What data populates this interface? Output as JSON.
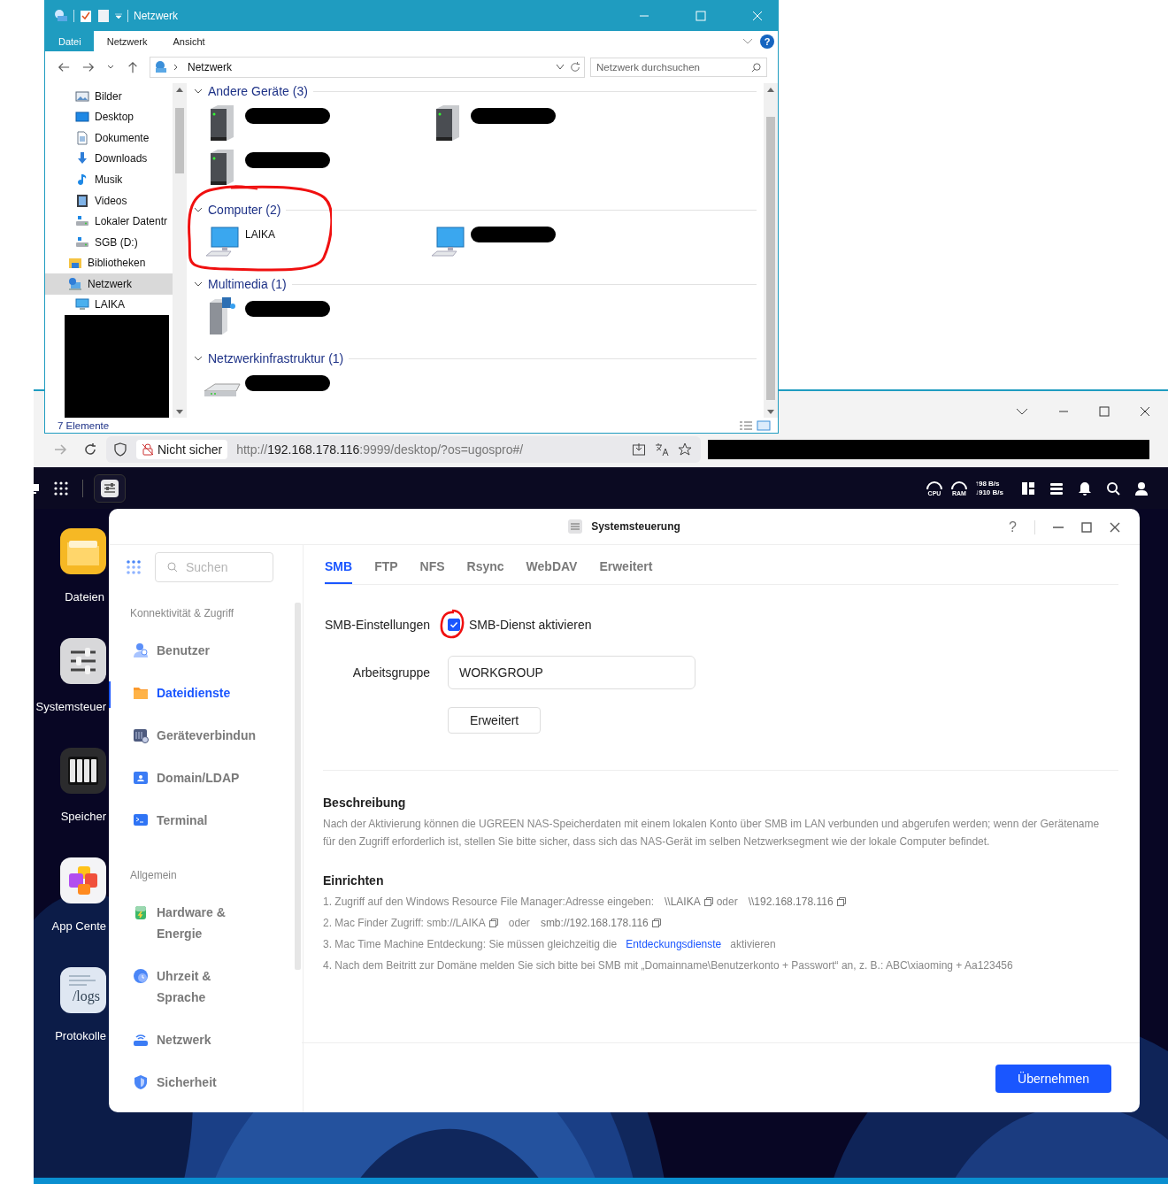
{
  "explorer": {
    "title": "Netzwerk",
    "ribbon_tabs": [
      {
        "label": "Datei",
        "selected": true
      },
      {
        "label": "Netzwerk",
        "selected": false
      },
      {
        "label": "Ansicht",
        "selected": false
      }
    ],
    "help": "?",
    "breadcrumb": "Netzwerk",
    "search": {
      "placeholder": "Netzwerk durchsuchen"
    },
    "nav_items": [
      {
        "label": "Bilder",
        "kind": "pictures",
        "selected": false
      },
      {
        "label": "Desktop",
        "kind": "desktop",
        "selected": false
      },
      {
        "label": "Dokumente",
        "kind": "documents",
        "selected": false
      },
      {
        "label": "Downloads",
        "kind": "downloads",
        "selected": false
      },
      {
        "label": "Musik",
        "kind": "music",
        "selected": false
      },
      {
        "label": "Videos",
        "kind": "videos",
        "selected": false
      },
      {
        "label": "Lokaler Datentr",
        "kind": "drive",
        "selected": false
      },
      {
        "label": "SGB (D:)",
        "kind": "drive",
        "selected": false
      },
      {
        "label": "Bibliotheken",
        "kind": "library",
        "selected": false
      },
      {
        "label": "Netzwerk",
        "kind": "network",
        "selected": true,
        "children": [
          {
            "label": "LAIKA",
            "kind": "computer",
            "selected": false
          }
        ]
      }
    ],
    "groups": [
      {
        "title": "Andere Geräte (3)",
        "devices": [
          {
            "kind": "server",
            "redacted": true
          },
          {
            "kind": "server",
            "redacted": true
          },
          {
            "kind": "server",
            "redacted": true
          }
        ]
      },
      {
        "title": "Computer (2)",
        "devices": [
          {
            "kind": "computer",
            "redacted": false,
            "name": "LAIKA"
          },
          {
            "kind": "computer",
            "redacted": true
          }
        ]
      },
      {
        "title": "Multimedia (1)",
        "devices": [
          {
            "kind": "media",
            "redacted": true
          }
        ]
      },
      {
        "title": "Netzwerkinfrastruktur (1)",
        "devices": [
          {
            "kind": "router",
            "redacted": true
          }
        ]
      }
    ],
    "status": "7 Elemente"
  },
  "browser": {
    "security": "Nicht sicher",
    "url_scheme": "http://",
    "url_host": "192.168.178.116",
    "url_rest": ":9999/desktop/?os=ugospro#/"
  },
  "topbar": {
    "cpu": "CPU",
    "ram": "RAM",
    "upload": "↑98 B/s",
    "download": "↓910 B/s"
  },
  "dock": [
    {
      "label": "Dateien",
      "kind": "files"
    },
    {
      "label": "Systemsteuer",
      "kind": "settings"
    },
    {
      "label": "Speicher",
      "kind": "storage"
    },
    {
      "label": "App Cente",
      "kind": "apps"
    },
    {
      "label": "Protokolle",
      "kind": "logs",
      "icon_text": "/logs"
    }
  ],
  "panel": {
    "title": "Systemsteuerung",
    "help": "?",
    "search": {
      "placeholder": "Suchen"
    },
    "sections": [
      {
        "title": "Konnektivität & Zugriff",
        "items": [
          {
            "label": "Benutzer",
            "kind": "user",
            "selected": false
          },
          {
            "label": "Dateidienste",
            "kind": "folder",
            "selected": true
          },
          {
            "label": "Geräteverbindun",
            "kind": "device",
            "selected": false
          },
          {
            "label": "Domain/LDAP",
            "kind": "domain",
            "selected": false
          },
          {
            "label": "Terminal",
            "kind": "terminal",
            "selected": false
          }
        ]
      },
      {
        "title": "Allgemein",
        "items": [
          {
            "label": "Hardware & Energie",
            "kind": "battery",
            "selected": false
          },
          {
            "label": "Uhrzeit & Sprache",
            "kind": "clock",
            "selected": false
          },
          {
            "label": "Netzwerk",
            "kind": "router",
            "selected": false
          },
          {
            "label": "Sicherheit",
            "kind": "shield",
            "selected": false
          }
        ]
      }
    ],
    "tabs": [
      {
        "label": "SMB",
        "selected": true
      },
      {
        "label": "FTP",
        "selected": false
      },
      {
        "label": "NFS",
        "selected": false
      },
      {
        "label": "Rsync",
        "selected": false
      },
      {
        "label": "WebDAV",
        "selected": false
      },
      {
        "label": "Erweitert",
        "selected": false
      }
    ],
    "smb_label": "SMB-Einstellungen",
    "smb_enabled": true,
    "smb_checkbox_label": "SMB-Dienst aktivieren",
    "workgroup_label": "Arbeitsgruppe",
    "workgroup": "WORKGROUP",
    "advanced_button": "Erweitert",
    "description_title": "Beschreibung",
    "description": "Nach der Aktivierung können die UGREEN NAS-Speicherdaten mit einem lokalen Konto über SMB im LAN verbunden und abgerufen werden; wenn der Gerätename für den Zugriff erforderlich ist, stellen Sie bitte sicher, dass sich das NAS-Gerät im selben Netzwerksegment wie der lokale Computer befindet.",
    "setup_title": "Einrichten",
    "steps": [
      [
        {
          "kind": "text",
          "text": "1. Zugriff auf den Windows Resource File Manager:Adresse eingeben:"
        },
        {
          "kind": "copy",
          "text": "\\\\LAIKA"
        },
        {
          "kind": "text",
          "text": "oder"
        },
        {
          "kind": "copy",
          "text": "\\\\192.168.178.116"
        }
      ],
      [
        {
          "kind": "text",
          "text": "2. Mac Finder Zugriff: smb://LAIKA"
        },
        {
          "kind": "copyicon"
        },
        {
          "kind": "text",
          "text": "oder"
        },
        {
          "kind": "copy",
          "text": "smb://192.168.178.116"
        }
      ],
      [
        {
          "kind": "text",
          "text": "3. Mac Time Machine Entdeckung: Sie müssen gleichzeitig die"
        },
        {
          "kind": "link",
          "text": "Entdeckungsdienste"
        },
        {
          "kind": "text",
          "text": "aktivieren"
        }
      ],
      [
        {
          "kind": "text",
          "text": "4. Nach dem Beitritt zur Domäne melden Sie sich bitte bei SMB mit „Domainname\\Benutzerkonto + Passwort“ an, z. B.: ABC\\xiaoming + Aa123456"
        }
      ]
    ],
    "apply_button": "Übernehmen"
  }
}
